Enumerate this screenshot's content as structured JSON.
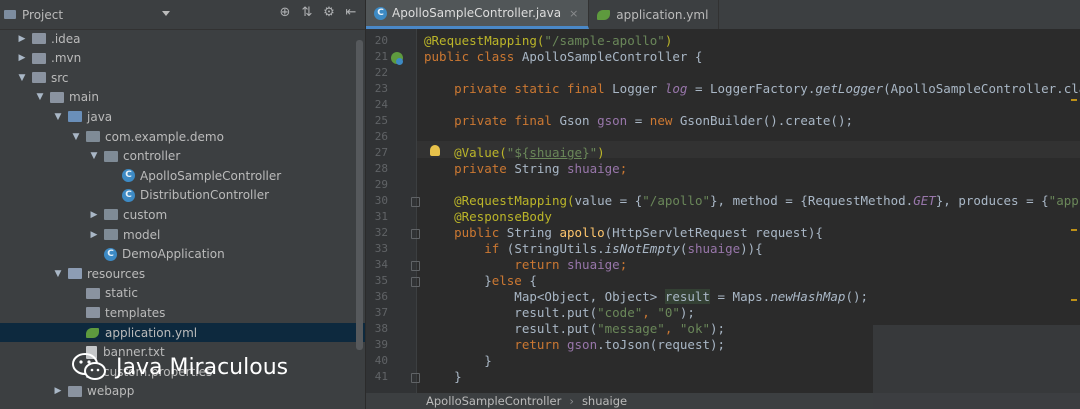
{
  "project_panel": {
    "title": "Project",
    "toolbar": [
      "⊕",
      "⇅",
      "⚙",
      "⇤"
    ],
    "tree": [
      {
        "label": ".idea",
        "depth": 1,
        "arrow": "▶",
        "icon": "folder-icon"
      },
      {
        "label": ".mvn",
        "depth": 1,
        "arrow": "▶",
        "icon": "folder-icon"
      },
      {
        "label": "src",
        "depth": 1,
        "arrow": "▼",
        "icon": "folder-icon"
      },
      {
        "label": "main",
        "depth": 2,
        "arrow": "▼",
        "icon": "folder-icon"
      },
      {
        "label": "java",
        "depth": 3,
        "arrow": "▼",
        "icon": "source-folder-icon"
      },
      {
        "label": "com.example.demo",
        "depth": 4,
        "arrow": "▼",
        "icon": "package-icon"
      },
      {
        "label": "controller",
        "depth": 5,
        "arrow": "▼",
        "icon": "package-icon"
      },
      {
        "label": "ApolloSampleController",
        "depth": 6,
        "arrow": "",
        "icon": "java-class-icon"
      },
      {
        "label": "DistributionController",
        "depth": 6,
        "arrow": "",
        "icon": "java-class-icon"
      },
      {
        "label": "custom",
        "depth": 5,
        "arrow": "▶",
        "icon": "package-icon"
      },
      {
        "label": "model",
        "depth": 5,
        "arrow": "▶",
        "icon": "package-icon"
      },
      {
        "label": "DemoApplication",
        "depth": 5,
        "arrow": "",
        "icon": "spring-app-icon"
      },
      {
        "label": "resources",
        "depth": 3,
        "arrow": "▼",
        "icon": "resources-folder-icon"
      },
      {
        "label": "static",
        "depth": 4,
        "arrow": "",
        "icon": "folder-icon"
      },
      {
        "label": "templates",
        "depth": 4,
        "arrow": "",
        "icon": "folder-icon"
      },
      {
        "label": "application.yml",
        "depth": 4,
        "arrow": "",
        "icon": "yaml-icon",
        "selected": true
      },
      {
        "label": "banner.txt",
        "depth": 4,
        "arrow": "",
        "icon": "text-file-icon"
      },
      {
        "label": "custom.properties",
        "depth": 4,
        "arrow": "",
        "icon": "properties-file-icon"
      },
      {
        "label": "webapp",
        "depth": 3,
        "arrow": "▶",
        "icon": "folder-icon"
      }
    ]
  },
  "tabs": [
    {
      "label": "ApolloSampleController.java",
      "active": true,
      "close": "×"
    },
    {
      "label": "application.yml",
      "active": false,
      "close": "×"
    }
  ],
  "editor": {
    "lines": [
      {
        "n": "20",
        "html_tokens": [
          [
            "an",
            "@RequestMapping("
          ],
          [
            "st",
            "\"/sample-apollo\""
          ],
          [
            "an",
            ")"
          ]
        ]
      },
      {
        "n": "21",
        "html_tokens": [
          [
            "kw",
            "public class "
          ],
          [
            "",
            "ApolloSampleController {"
          ]
        ]
      },
      {
        "n": "22",
        "html_tokens": []
      },
      {
        "n": "23",
        "html_tokens": [
          [
            "",
            "    "
          ],
          [
            "kw",
            "private static final "
          ],
          [
            "",
            "Logger "
          ],
          [
            "fld it",
            "log"
          ],
          [
            "",
            " = LoggerFactory."
          ],
          [
            "it",
            "getLogger"
          ],
          [
            "",
            "(ApolloSampleController.cla"
          ]
        ]
      },
      {
        "n": "24",
        "html_tokens": []
      },
      {
        "n": "25",
        "html_tokens": [
          [
            "",
            "    "
          ],
          [
            "kw",
            "private final "
          ],
          [
            "",
            "Gson "
          ],
          [
            "fld",
            "gson"
          ],
          [
            "",
            " = "
          ],
          [
            "kw",
            "new "
          ],
          [
            "",
            "GsonBuilder().create();"
          ]
        ]
      },
      {
        "n": "26",
        "html_tokens": []
      },
      {
        "n": "27",
        "html_tokens": [
          [
            "",
            "    "
          ],
          [
            "an",
            "@Value("
          ],
          [
            "st",
            "\"${"
          ],
          [
            "st ul",
            "shuaige"
          ],
          [
            "st",
            "}\""
          ],
          [
            "an",
            ")"
          ]
        ]
      },
      {
        "n": "28",
        "html_tokens": [
          [
            "",
            "    "
          ],
          [
            "kw",
            "private "
          ],
          [
            "",
            "String "
          ],
          [
            "fld",
            "shuaige"
          ],
          [
            "kw",
            ";"
          ]
        ]
      },
      {
        "n": "29",
        "html_tokens": []
      },
      {
        "n": "30",
        "html_tokens": [
          [
            "",
            "    "
          ],
          [
            "an",
            "@RequestMapping("
          ],
          [
            "",
            "value = {"
          ],
          [
            "st",
            "\"/apollo\""
          ],
          [
            "",
            "}, method = {RequestMethod."
          ],
          [
            "fld it",
            "GET"
          ],
          [
            "",
            "}, produces = {"
          ],
          [
            "st",
            "\"app"
          ]
        ]
      },
      {
        "n": "31",
        "html_tokens": [
          [
            "",
            "    "
          ],
          [
            "an",
            "@ResponseBody"
          ]
        ]
      },
      {
        "n": "32",
        "html_tokens": [
          [
            "",
            "    "
          ],
          [
            "kw",
            "public "
          ],
          [
            "",
            "String "
          ],
          [
            "fn",
            "apollo"
          ],
          [
            "",
            "(HttpServletRequest request){"
          ]
        ]
      },
      {
        "n": "33",
        "html_tokens": [
          [
            "",
            "        "
          ],
          [
            "kw",
            "if "
          ],
          [
            "",
            "(StringUtils."
          ],
          [
            "it",
            "isNotEmpty"
          ],
          [
            "",
            "("
          ],
          [
            "fld",
            "shuaige"
          ],
          [
            "",
            ")){"
          ]
        ]
      },
      {
        "n": "34",
        "html_tokens": [
          [
            "",
            "            "
          ],
          [
            "kw",
            "return "
          ],
          [
            "fld",
            "shuaige"
          ],
          [
            "kw",
            ";"
          ]
        ]
      },
      {
        "n": "35",
        "html_tokens": [
          [
            "",
            "        }"
          ],
          [
            "kw",
            "else "
          ],
          [
            "",
            "{"
          ]
        ]
      },
      {
        "n": "36",
        "html_tokens": [
          [
            "",
            "            Map<Object, Object> "
          ],
          [
            "hlw",
            "result"
          ],
          [
            "",
            " = Maps."
          ],
          [
            "it",
            "newHashMap"
          ],
          [
            "",
            "();"
          ]
        ]
      },
      {
        "n": "37",
        "html_tokens": [
          [
            "",
            "            result.put("
          ],
          [
            "st",
            "\"code\""
          ],
          [
            "kw",
            ", "
          ],
          [
            "st",
            "\"0\""
          ],
          [
            "",
            ");"
          ]
        ]
      },
      {
        "n": "38",
        "html_tokens": [
          [
            "",
            "            result.put("
          ],
          [
            "st",
            "\"message\""
          ],
          [
            "kw",
            ", "
          ],
          [
            "st",
            "\"ok\""
          ],
          [
            "",
            ");"
          ]
        ]
      },
      {
        "n": "39",
        "html_tokens": [
          [
            "",
            "            "
          ],
          [
            "kw",
            "return "
          ],
          [
            "fld",
            "gson"
          ],
          [
            "",
            ".toJson(request);"
          ]
        ]
      },
      {
        "n": "40",
        "html_tokens": [
          [
            "",
            "        }"
          ]
        ]
      },
      {
        "n": "41",
        "html_tokens": [
          [
            "",
            "    }"
          ]
        ]
      }
    ]
  },
  "breadcrumb": [
    "ApolloSampleController",
    "shuaige"
  ],
  "breadcrumb_sep": "›",
  "watermark": {
    "text": "Java Miraculous"
  }
}
